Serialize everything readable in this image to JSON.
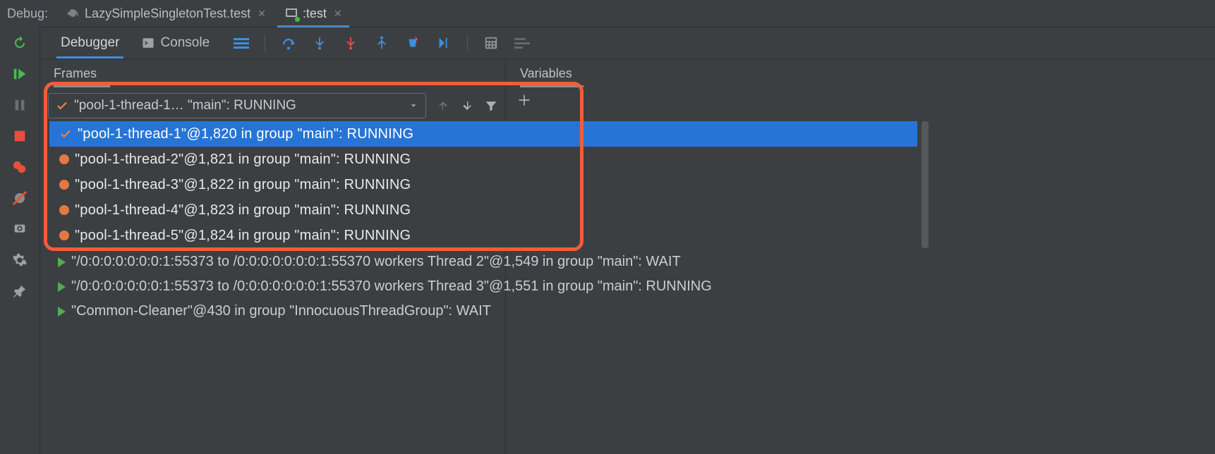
{
  "top": {
    "debug_label": "Debug:",
    "tabs": [
      {
        "label": "LazySimpleSingletonTest.test",
        "active": false
      },
      {
        "label": ":test",
        "active": true
      }
    ]
  },
  "tool_tabs": {
    "debugger": "Debugger",
    "console": "Console"
  },
  "panels": {
    "frames": "Frames",
    "variables": "Variables"
  },
  "thread_selector": {
    "label": "\"pool-1-thread-1… \"main\": RUNNING"
  },
  "thread_menu": [
    {
      "label": "\"pool-1-thread-1\"@1,820 in group \"main\": RUNNING",
      "mark": "check",
      "selected": true
    },
    {
      "label": "\"pool-1-thread-2\"@1,821 in group \"main\": RUNNING",
      "mark": "bullet",
      "selected": false
    },
    {
      "label": "\"pool-1-thread-3\"@1,822 in group \"main\": RUNNING",
      "mark": "bullet",
      "selected": false
    },
    {
      "label": "\"pool-1-thread-4\"@1,823 in group \"main\": RUNNING",
      "mark": "bullet",
      "selected": false
    },
    {
      "label": "\"pool-1-thread-5\"@1,824 in group \"main\": RUNNING",
      "mark": "bullet",
      "selected": false
    }
  ],
  "other_threads": [
    "\"/0:0:0:0:0:0:0:1:55373 to /0:0:0:0:0:0:0:1:55370 workers Thread 2\"@1,549 in group \"main\": WAIT",
    "\"/0:0:0:0:0:0:0:1:55373 to /0:0:0:0:0:0:0:1:55370 workers Thread 3\"@1,551 in group \"main\": RUNNING",
    "\"Common-Cleaner\"@430 in group \"InnocuousThreadGroup\": WAIT"
  ],
  "colors": {
    "accent_blue": "#2675d6",
    "bullet_orange": "#e37941",
    "highlight_red": "#f25c3c",
    "play_green": "#4caf50"
  }
}
